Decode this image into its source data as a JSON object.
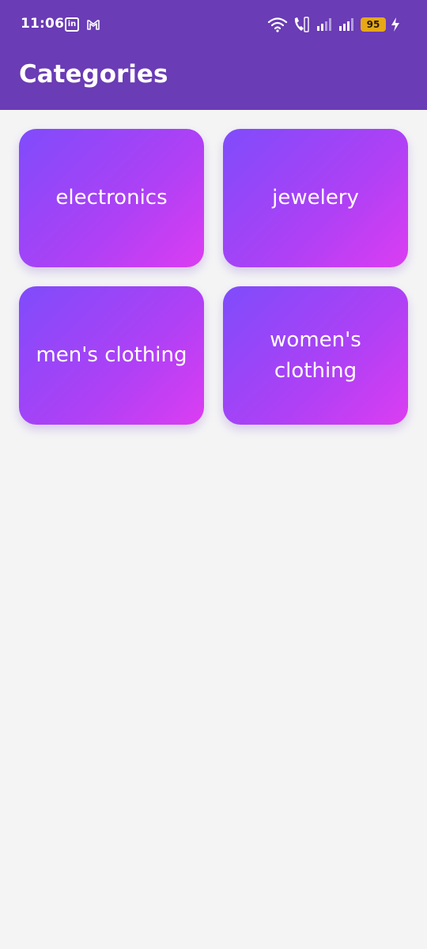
{
  "status_bar": {
    "time": "11:06",
    "linkedin_icon": "linkedin-icon",
    "gmail_icon": "gmail-icon",
    "battery": "95"
  },
  "header": {
    "title": "Categories"
  },
  "categories": [
    {
      "label": "electronics"
    },
    {
      "label": "jewelery"
    },
    {
      "label": "men's clothing"
    },
    {
      "label": "women's clothing"
    }
  ],
  "colors": {
    "app_bar": "#6a3cb5",
    "card_gradient_start": "#7f4cfb",
    "card_gradient_end": "#dc3df2",
    "background": "#f4f4f5",
    "battery": "#e6a817"
  }
}
